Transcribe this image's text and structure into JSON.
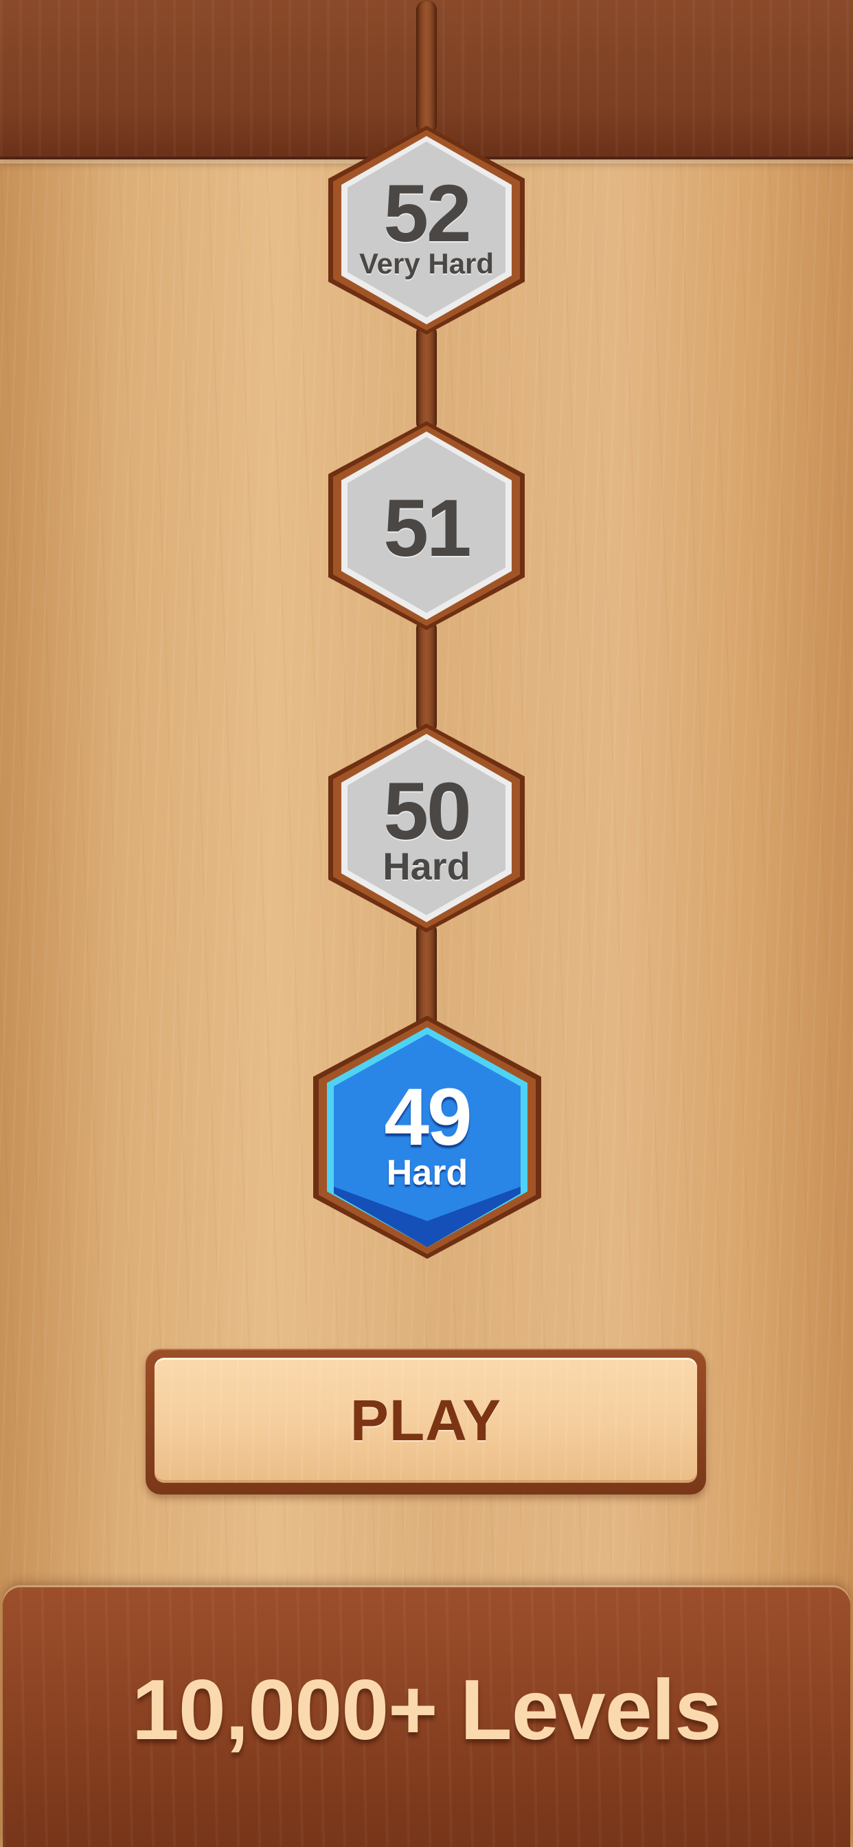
{
  "header": {
    "bar_color": "#7c3f22"
  },
  "level_path": {
    "track_color": "#8b4a26",
    "levels": [
      {
        "number": "52",
        "difficulty": "Very Hard",
        "state": "locked",
        "color": "#c9c9c9"
      },
      {
        "number": "51",
        "difficulty": "",
        "state": "locked",
        "color": "#c9c9c9"
      },
      {
        "number": "50",
        "difficulty": "Hard",
        "state": "locked",
        "color": "#c9c9c9"
      },
      {
        "number": "49",
        "difficulty": "Hard",
        "state": "current",
        "color": "#1f73d8"
      }
    ]
  },
  "play_button": {
    "label": "PLAY",
    "color": "#f4cd9c",
    "text_color": "#7b3414"
  },
  "footer": {
    "caption": "10,000+ Levels",
    "panel_color": "#8a4222",
    "text_color": "#fbd9ae"
  }
}
